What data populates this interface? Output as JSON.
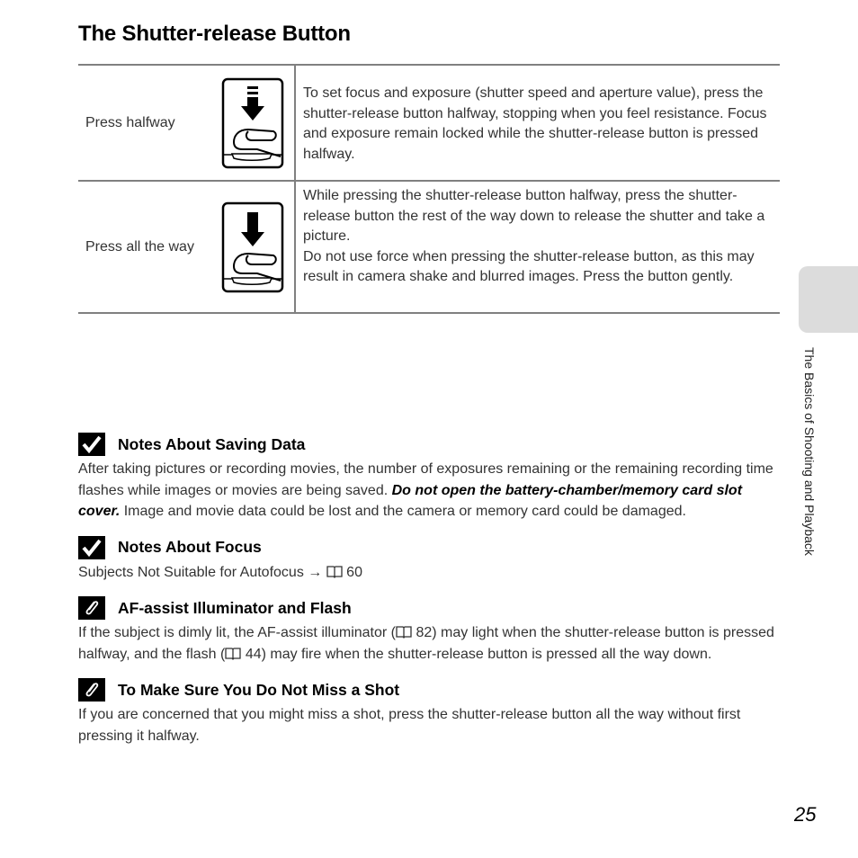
{
  "page": {
    "title": "The Shutter-release Button",
    "side_tab_text": "The Basics of Shooting and Playback",
    "page_number": "25"
  },
  "table": {
    "rows": [
      {
        "label": "Press halfway",
        "icon": "press-halfway-icon",
        "description": "To set focus and exposure (shutter speed and aperture value), press the shutter-release button halfway, stopping when you feel resistance. Focus and exposure remain locked while the shutter-release button is pressed halfway."
      },
      {
        "label": "Press all the way",
        "icon": "press-fully-icon",
        "description_1": "While pressing the shutter-release button halfway, press the shutter-release button the rest of the way down to release the shutter and take a picture.",
        "description_2": "Do not use force when pressing the shutter-release button, as this may result in camera shake and blurred images. Press the button gently."
      }
    ]
  },
  "notes": [
    {
      "icon": "check-icon",
      "title": "Notes About Saving Data",
      "body_before": "After taking pictures or recording movies, the number of exposures remaining or the remaining recording time flashes while images or movies are being saved. ",
      "body_bold": "Do not open the battery-chamber/memory card slot cover.",
      "body_after": " Image and movie data could be lost and the camera or memory card could be damaged."
    },
    {
      "icon": "check-icon",
      "title": "Notes About Focus",
      "body": "Subjects Not Suitable for Autofocus →",
      "ref_page": "60"
    },
    {
      "icon": "paperclip-icon",
      "title": "AF-assist Illuminator and Flash",
      "body_1": "If the subject is dimly lit, the AF-assist illuminator (",
      "ref_1": "82",
      "body_2": ") may light when the shutter-release button is pressed halfway, and the flash (",
      "ref_2": "44",
      "body_3": ") may fire when the shutter-release button is pressed all the way down."
    },
    {
      "icon": "paperclip-icon",
      "title": "To Make Sure You Do Not Miss a Shot",
      "body": "If you are concerned that you might miss a shot, press the shutter-release button all the way without first pressing it halfway."
    }
  ]
}
